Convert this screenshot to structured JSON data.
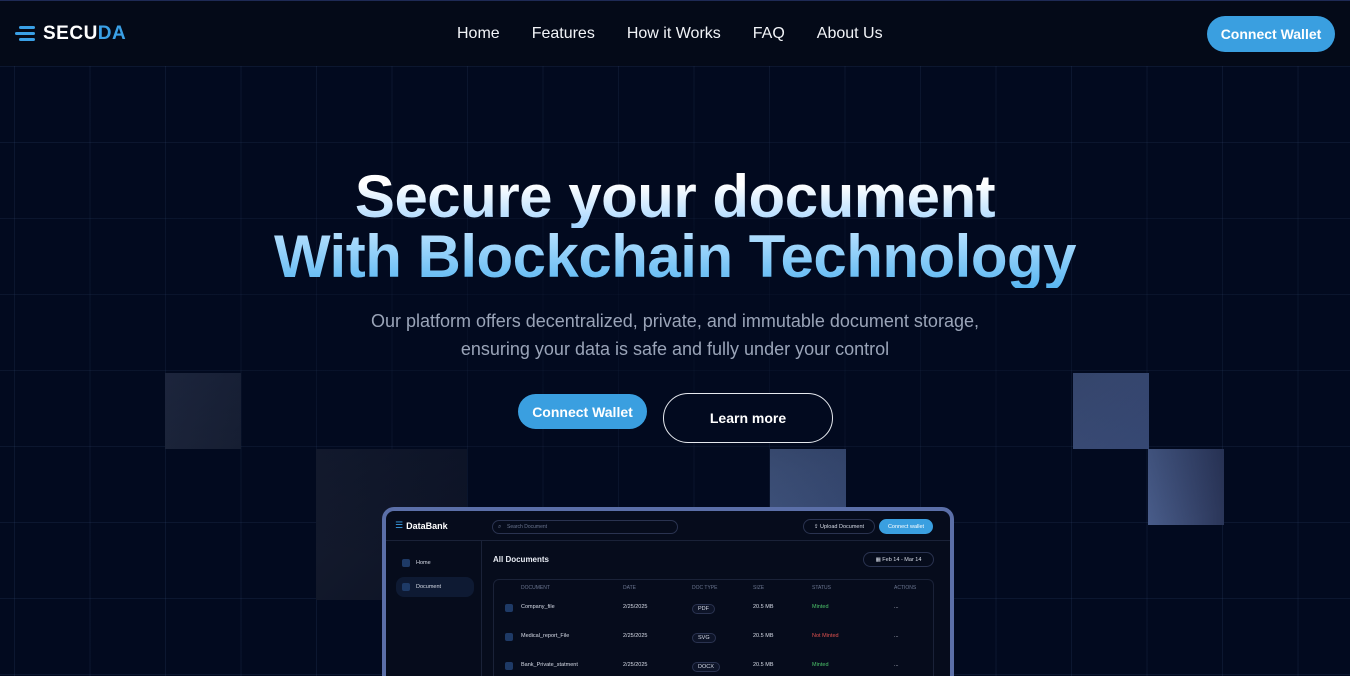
{
  "brand": {
    "name_part1": "SECU",
    "name_part2": "DA",
    "accent_color": "#3aa0e6"
  },
  "nav": {
    "links": [
      "Home",
      "Features",
      "How it Works",
      "FAQ",
      "About Us"
    ],
    "cta_label": "Connect Wallet"
  },
  "hero": {
    "title_line1": "Secure your document",
    "title_line2": "With Blockchain Technology",
    "subtitle_line1": "Our platform offers decentralized, private, and immutable document storage,",
    "subtitle_line2": "ensuring your data is safe and fully under your control",
    "primary_button": "Connect Wallet",
    "secondary_button": "Learn more"
  },
  "mockup": {
    "logo": "DataBank",
    "search_placeholder": "Search Document",
    "upload_label": "Upload Document",
    "connect_label": "Connect wallet",
    "sidebar": [
      "Home",
      "Document"
    ],
    "section_title": "All Documents",
    "date_range": "Feb 14 - Mar 14",
    "columns": [
      "DOCUMENT",
      "DATE",
      "DOC TYPE",
      "SIZE",
      "STATUS",
      "ACTIONS"
    ],
    "rows": [
      {
        "name": "Company_file",
        "date": "2/25/2025",
        "type": "PDF",
        "size": "20.5 MB",
        "status": "Minted",
        "actions": "..."
      },
      {
        "name": "Medical_report_File",
        "date": "2/25/2025",
        "type": "SVG",
        "size": "20.5 MB",
        "status": "Not Minted",
        "actions": "..."
      },
      {
        "name": "Bank_Private_statment",
        "date": "2/25/2025",
        "type": "DOCX",
        "size": "20.5 MB",
        "status": "Minted",
        "actions": "..."
      }
    ]
  },
  "colors": {
    "background": "#020a1f",
    "primary_button": "#3a9fe0",
    "minted": "#4cc46a",
    "not_minted": "#e0524f"
  }
}
